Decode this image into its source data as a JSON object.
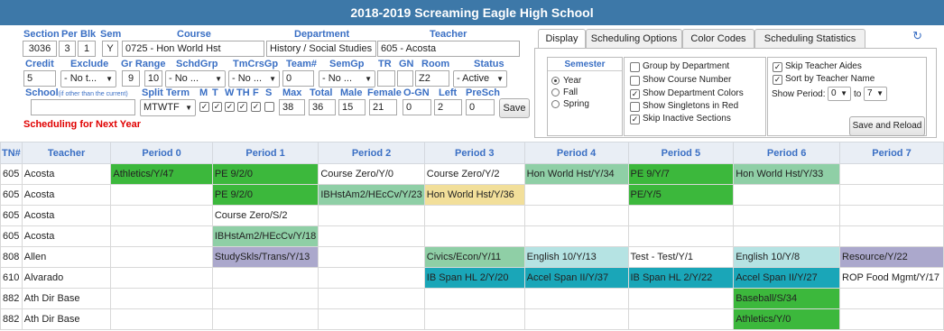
{
  "title": "2018-2019 Screaming Eagle High School",
  "form": {
    "row1_labels": {
      "section": "Section",
      "per": "Per",
      "blk": "Blk",
      "sem": "Sem",
      "course": "Course",
      "department": "Department",
      "teacher": "Teacher"
    },
    "row1_values": {
      "section": "3036",
      "per": "3",
      "blk": "1",
      "sem": "Y",
      "course": "0725 - Hon World Hst",
      "department": "History / Social Studies",
      "teacher": "605 - Acosta"
    },
    "row2_labels": {
      "credit": "Credit",
      "exclude": "Exclude",
      "gr_range": "Gr Range",
      "schdgrp": "SchdGrp",
      "tmcrsgp": "TmCrsGp",
      "team": "Team#",
      "semgp": "SemGp",
      "tr": "TR",
      "gn": "GN",
      "room": "Room",
      "status": "Status"
    },
    "row2_values": {
      "credit": "5",
      "exclude": "- No t...",
      "gr_low": "9",
      "gr_high": "10",
      "schdgrp": "- No ...",
      "tmcrsgp": "- No ...",
      "team": "0",
      "semgp": "- No ...",
      "tr": "",
      "gn": "",
      "room": "Z2",
      "status": "- Active"
    },
    "row3_labels": {
      "school": "School",
      "school_note": "(if other than the current)",
      "split_term": "Split Term",
      "days": [
        "M",
        "T",
        "W",
        "TH",
        "F",
        "S"
      ],
      "max": "Max",
      "total": "Total",
      "male": "Male",
      "female": "Female",
      "o_gn": "O-GN",
      "left": "Left",
      "presch": "PreSch"
    },
    "row3_values": {
      "school": "",
      "split_term": "MTWTF",
      "days_checked": [
        true,
        true,
        true,
        true,
        true,
        false
      ],
      "max": "38",
      "total": "36",
      "male": "15",
      "female": "21",
      "o_gn": "0",
      "left": "2",
      "presch": "0"
    },
    "save_label": "Save",
    "next_year_note": "Scheduling for Next Year"
  },
  "options": {
    "tabs": [
      "Display",
      "Scheduling Options",
      "Color Codes",
      "Scheduling Statistics"
    ],
    "active_tab": "Display",
    "semester_label": "Semester",
    "semester_options": [
      "Year",
      "Fall",
      "Spring"
    ],
    "semester_selected": "Year",
    "display_checks": [
      {
        "label": "Group by Department",
        "checked": false
      },
      {
        "label": "Show Course Number",
        "checked": false
      },
      {
        "label": "Show Department Colors",
        "checked": true
      },
      {
        "label": "Show Singletons in Red",
        "checked": false
      },
      {
        "label": "Skip Inactive Sections",
        "checked": true
      }
    ],
    "right_checks": [
      {
        "label": "Skip Teacher Aides",
        "checked": true
      },
      {
        "label": "Sort by Teacher Name",
        "checked": true
      }
    ],
    "show_period_label": "Show Period:",
    "period_from": "0",
    "period_to": "7",
    "to_label": "to",
    "save_reload_label": "Save and Reload"
  },
  "grid": {
    "headers": [
      "TN#",
      "Teacher",
      "Period 0",
      "Period 1",
      "Period 2",
      "Period 3",
      "Period 4",
      "Period 5",
      "Period 6",
      "Period 7"
    ],
    "rows": [
      {
        "tn": "605",
        "teacher": "Acosta",
        "cells": [
          {
            "text": "Athletics/Y/47",
            "color": "#3cb83c"
          },
          {
            "text": "PE 9/2/0",
            "color": "#3cb83c"
          },
          {
            "text": "Course Zero/Y/0",
            "color": ""
          },
          {
            "text": "Course Zero/Y/2",
            "color": ""
          },
          {
            "text": "Hon World Hst/Y/34",
            "color": "#8fcfa6"
          },
          {
            "text": "PE 9/Y/7",
            "color": "#3cb83c"
          },
          {
            "text": "Hon World Hst/Y/33",
            "color": "#8fcfa6"
          },
          {
            "text": "",
            "color": ""
          }
        ]
      },
      {
        "tn": "605",
        "teacher": "Acosta",
        "cells": [
          {
            "text": "",
            "color": ""
          },
          {
            "text": "PE 9/2/0",
            "color": "#3cb83c"
          },
          {
            "text": "IBHstAm2/HEcCv/Y/23",
            "color": "#8fcfa6"
          },
          {
            "text": "Hon World Hst/Y/36",
            "color": "#f2df9a"
          },
          {
            "text": "",
            "color": ""
          },
          {
            "text": "PE/Y/5",
            "color": "#3cb83c"
          },
          {
            "text": "",
            "color": ""
          },
          {
            "text": "",
            "color": ""
          }
        ]
      },
      {
        "tn": "605",
        "teacher": "Acosta",
        "cells": [
          {
            "text": "",
            "color": ""
          },
          {
            "text": "Course Zero/S/2",
            "color": ""
          },
          {
            "text": "",
            "color": ""
          },
          {
            "text": "",
            "color": ""
          },
          {
            "text": "",
            "color": ""
          },
          {
            "text": "",
            "color": ""
          },
          {
            "text": "",
            "color": ""
          },
          {
            "text": "",
            "color": ""
          }
        ]
      },
      {
        "tn": "605",
        "teacher": "Acosta",
        "cells": [
          {
            "text": "",
            "color": ""
          },
          {
            "text": "IBHstAm2/HEcCv/Y/18",
            "color": "#8fcfa6"
          },
          {
            "text": "",
            "color": ""
          },
          {
            "text": "",
            "color": ""
          },
          {
            "text": "",
            "color": ""
          },
          {
            "text": "",
            "color": ""
          },
          {
            "text": "",
            "color": ""
          },
          {
            "text": "",
            "color": ""
          }
        ]
      },
      {
        "tn": "808",
        "teacher": "Allen",
        "cells": [
          {
            "text": "",
            "color": ""
          },
          {
            "text": "StudySkls/Trans/Y/13",
            "color": "#aba8cc"
          },
          {
            "text": "",
            "color": ""
          },
          {
            "text": "Civics/Econ/Y/11",
            "color": "#8fcfa6"
          },
          {
            "text": "English 10/Y/13",
            "color": "#b5e3e3"
          },
          {
            "text": "Test - Test/Y/1",
            "color": ""
          },
          {
            "text": "English 10/Y/8",
            "color": "#b5e3e3"
          },
          {
            "text": "Resource/Y/22",
            "color": "#aba8cc"
          }
        ]
      },
      {
        "tn": "610",
        "teacher": "Alvarado",
        "cells": [
          {
            "text": "",
            "color": ""
          },
          {
            "text": "",
            "color": ""
          },
          {
            "text": "",
            "color": ""
          },
          {
            "text": "IB Span HL 2/Y/20",
            "color": "#1aa6b8"
          },
          {
            "text": "Accel Span II/Y/37",
            "color": "#1aa6b8"
          },
          {
            "text": "IB Span HL 2/Y/22",
            "color": "#1aa6b8"
          },
          {
            "text": "Accel Span II/Y/27",
            "color": "#1aa6b8"
          },
          {
            "text": "ROP Food Mgmt/Y/17",
            "color": ""
          }
        ]
      },
      {
        "tn": "882",
        "teacher": "Ath Dir Base",
        "cells": [
          {
            "text": "",
            "color": ""
          },
          {
            "text": "",
            "color": ""
          },
          {
            "text": "",
            "color": ""
          },
          {
            "text": "",
            "color": ""
          },
          {
            "text": "",
            "color": ""
          },
          {
            "text": "",
            "color": ""
          },
          {
            "text": "Baseball/S/34",
            "color": "#3cb83c"
          },
          {
            "text": "",
            "color": ""
          }
        ]
      },
      {
        "tn": "882",
        "teacher": "Ath Dir Base",
        "cells": [
          {
            "text": "",
            "color": ""
          },
          {
            "text": "",
            "color": ""
          },
          {
            "text": "",
            "color": ""
          },
          {
            "text": "",
            "color": ""
          },
          {
            "text": "",
            "color": ""
          },
          {
            "text": "",
            "color": ""
          },
          {
            "text": "Athletics/Y/0",
            "color": "#3cb83c"
          },
          {
            "text": "",
            "color": ""
          }
        ]
      }
    ]
  }
}
